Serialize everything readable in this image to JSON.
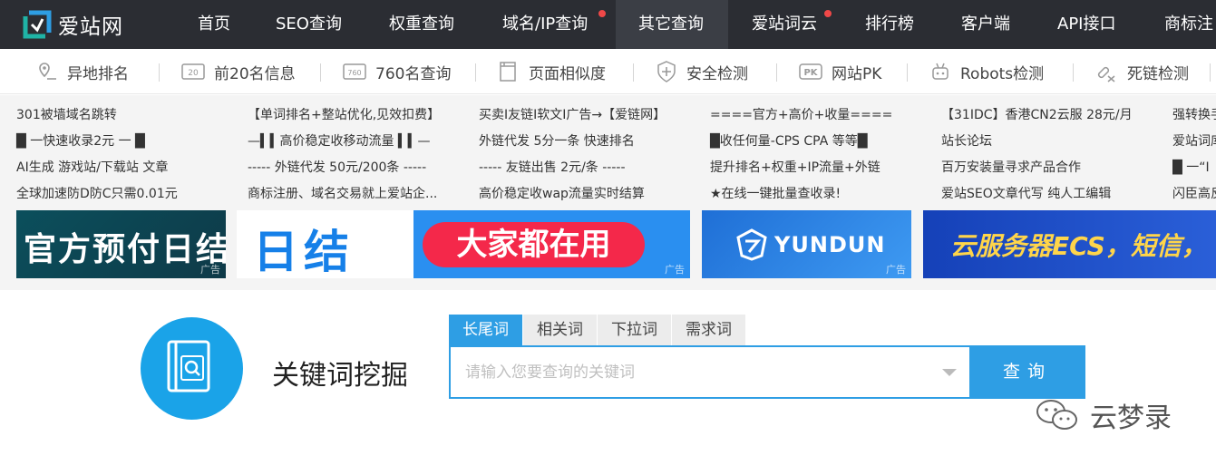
{
  "logo": {
    "text": "爱站网"
  },
  "nav": [
    {
      "label": "首页",
      "dot": false,
      "active": false
    },
    {
      "label": "SEO查询",
      "dot": false,
      "active": false
    },
    {
      "label": "权重查询",
      "dot": false,
      "active": false
    },
    {
      "label": "域名/IP查询",
      "dot": true,
      "active": false
    },
    {
      "label": "其它查询",
      "dot": false,
      "active": true
    },
    {
      "label": "爱站词云",
      "dot": true,
      "active": false
    },
    {
      "label": "排行榜",
      "dot": false,
      "active": false
    },
    {
      "label": "客户端",
      "dot": false,
      "active": false
    },
    {
      "label": "API接口",
      "dot": false,
      "active": false
    },
    {
      "label": "商标注",
      "dot": false,
      "active": false
    }
  ],
  "subnav": [
    {
      "label": "异地排名",
      "icon": "location-pin-icon"
    },
    {
      "label": "前20名信息",
      "icon": "badge-20-icon"
    },
    {
      "label": "760名查询",
      "icon": "badge-760-icon"
    },
    {
      "label": "页面相似度",
      "icon": "pages-icon"
    },
    {
      "label": "安全检测",
      "icon": "shield-plus-icon"
    },
    {
      "label": "网站PK",
      "icon": "pk-icon"
    },
    {
      "label": "Robots检测",
      "icon": "robot-icon"
    },
    {
      "label": "死链检测",
      "icon": "broken-link-icon"
    }
  ],
  "ad_columns": [
    [
      "301被墙域名跳转",
      "█ 一快速收录2元 一 █",
      "AI生成 游戏站/下载站 文章",
      "全球加速防D防C只需0.01元"
    ],
    [
      "【单词排名+整站优化,见效扣费】",
      "—▍▍高价稳定收移动流量 ▍▍—",
      "----- 外链代发 50元/200条 -----",
      "商标注册、域名交易就上爱站企..."
    ],
    [
      "买卖I友链I软文I广告→【爱链网】",
      "外链代发 5分一条 快速排名",
      "----- 友链出售 2元/条 -----",
      "高价稳定收wap流量实时结算"
    ],
    [
      "====官方+高价+收量====",
      "█收任何量-CPS CPA 等等█",
      "提升排名+权重+IP流量+外链",
      "★在线一键批量查收录!"
    ],
    [
      "【31IDC】香港CN2云服 28元/月",
      "站长论坛",
      "百万安装量寻求产品合作",
      "爱站SEO文章代写 纯人工编辑"
    ],
    [
      "强转换手",
      "爱站词库",
      "█ 一“I",
      "闪臣高反"
    ]
  ],
  "banners": [
    {
      "text": "官方预付日结",
      "tag": "广告"
    },
    {
      "text_a": "日结",
      "text_b": "大家都在用",
      "tag": "广告"
    },
    {
      "text": "YUNDUN",
      "tag": "广告"
    },
    {
      "text": "云服务器ECS，短信，",
      "tag": ""
    }
  ],
  "tool": {
    "title": "关键词挖掘"
  },
  "tabs": [
    {
      "label": "长尾词",
      "active": true
    },
    {
      "label": "相关词",
      "active": false
    },
    {
      "label": "下拉词",
      "active": false
    },
    {
      "label": "需求词",
      "active": false
    }
  ],
  "search": {
    "placeholder": "请输入您要查询的关键词",
    "value": "",
    "button": "查询"
  },
  "watermark": {
    "text": "云梦录"
  },
  "colors": {
    "nav_bg": "#2b2d33",
    "accent": "#2e9ee4",
    "circle": "#1aa3e8",
    "dot": "#f04848"
  }
}
